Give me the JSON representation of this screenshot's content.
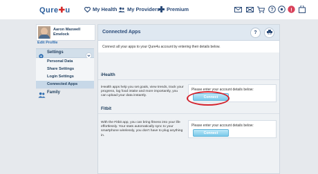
{
  "header": {
    "logo_text": "Qure",
    "logo_suffix": "u",
    "nav": [
      {
        "label": "My Health",
        "icon": "heart-icon"
      },
      {
        "label": "My Providers",
        "icon": "people-icon"
      },
      {
        "label": "Premium",
        "icon": "plus-icon"
      }
    ],
    "icons": [
      "mail-icon",
      "mail-icon",
      "shopping-cart-icon",
      "help-icon",
      "settings-icon",
      "alert-icon",
      "bag-icon"
    ]
  },
  "sidebar": {
    "profile_name_line1": "Aaron Maxwell",
    "profile_name_line2": "Emelock",
    "edit_profile": "Edit Profile",
    "settings_label": "Settings",
    "items": [
      {
        "label": "Personal Data"
      },
      {
        "label": "Share Settings"
      },
      {
        "label": "Login Settings"
      },
      {
        "label": "Connected Apps",
        "active": true
      }
    ],
    "family_label": "Family"
  },
  "panel": {
    "title": "Connected Apps",
    "intro": "Connect all your apps to your Qure4u account by entering their details below.",
    "sections": [
      {
        "title": "iHealth",
        "description": "iHealth apps help you set goals, view trends, track your progress, log food intake and more importantly, you can upload your data instantly.",
        "prompt": "Please enter your account details below:",
        "button": "Connect",
        "highlighted": true
      },
      {
        "title": "Fitbit",
        "description": "With the Fitbit app, you can bring fitness into your life effortlessly. Your stats automatically sync to your smartphone wirelessly, you don't have to plug anything in.",
        "prompt": "Please enter your account details below:",
        "button": "Connect",
        "highlighted": false
      }
    ]
  },
  "colors": {
    "brand": "#2a5d9b",
    "accent_red": "#d42a2a",
    "connect_button": "#79c9ea",
    "highlight_ring": "#d4202a"
  }
}
